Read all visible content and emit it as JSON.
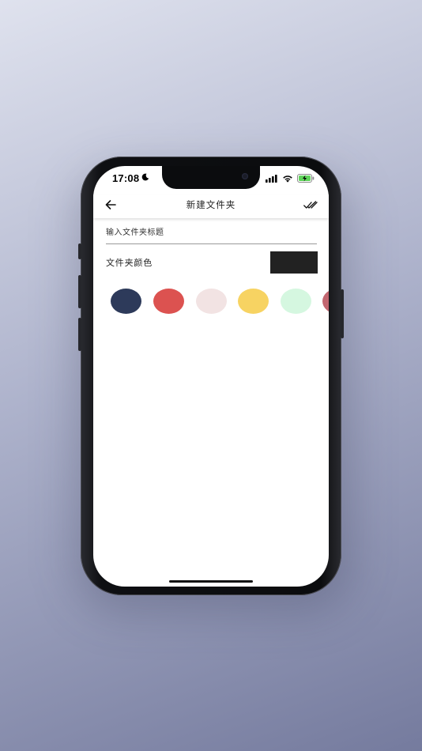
{
  "status_bar": {
    "time": "17:08"
  },
  "nav": {
    "title": "新建文件夹"
  },
  "form": {
    "title_placeholder": "输入文件夹标题",
    "title_value": "",
    "color_label": "文件夹颜色",
    "selected_color": "#222222"
  },
  "swatches": [
    {
      "color": "#2d3a5a"
    },
    {
      "color": "#dc5250"
    },
    {
      "color": "#f2e3e3"
    },
    {
      "color": "#f7d362"
    },
    {
      "color": "#d5f7e0"
    },
    {
      "color": "#c26670"
    }
  ],
  "colors": {
    "background_top": "#dfe2ee",
    "background_bottom": "#757b9e",
    "battery_fill": "#5fd35a"
  }
}
